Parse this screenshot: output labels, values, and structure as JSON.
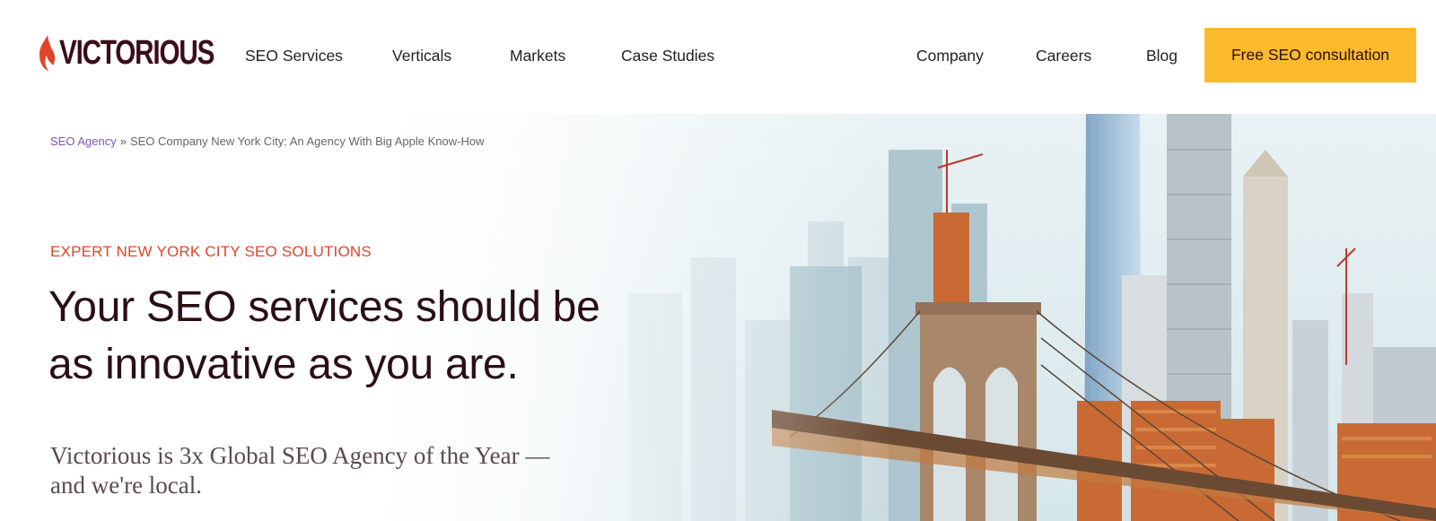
{
  "brand": {
    "name": "VICTORIOUS",
    "colors": {
      "primary": "#3b0d18",
      "accent": "#e0452a",
      "cta": "#fbb92c",
      "link": "#7c58a6"
    }
  },
  "nav": {
    "left": [
      "SEO Services",
      "Verticals",
      "Markets",
      "Case Studies"
    ],
    "right": [
      "Company",
      "Careers",
      "Blog"
    ],
    "cta": "Free SEO consultation"
  },
  "breadcrumb": {
    "parent": "SEO Agency",
    "separator": "»",
    "current": "SEO Company New York City: An Agency With Big Apple Know-How"
  },
  "hero": {
    "eyebrow": "EXPERT NEW YORK CITY SEO SOLUTIONS",
    "headline_line1": "Your SEO services should be",
    "headline_line2": "as innovative as you are.",
    "subhead_line1": "Victorious is 3x Global SEO Agency of the Year —",
    "subhead_line2": "and we're local."
  }
}
